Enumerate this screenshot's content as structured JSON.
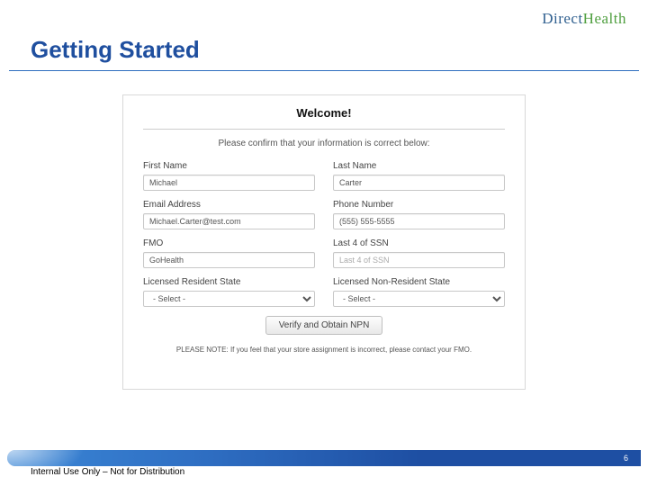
{
  "brand": {
    "part1": "Direct",
    "part2": "Health"
  },
  "title": "Getting Started",
  "welcome": "Welcome!",
  "confirm_text": "Please confirm that your information is correct below:",
  "fields": {
    "first_name": {
      "label": "First Name",
      "value": "Michael"
    },
    "last_name": {
      "label": "Last Name",
      "value": "Carter"
    },
    "email": {
      "label": "Email Address",
      "value": "Michael.Carter@test.com"
    },
    "phone": {
      "label": "Phone Number",
      "value": "(555) 555-5555"
    },
    "fmo": {
      "label": "FMO",
      "value": "GoHealth"
    },
    "ssn": {
      "label": "Last 4 of SSN",
      "value": "",
      "placeholder": "Last 4 of SSN"
    },
    "res_state": {
      "label": "Licensed Resident State",
      "selected": "- Select -"
    },
    "nonres_state": {
      "label": "Licensed Non-Resident State",
      "selected": "- Select -"
    }
  },
  "button_label": "Verify and Obtain NPN",
  "note": "PLEASE NOTE: If you feel that your store assignment is incorrect, please contact your FMO.",
  "footer": {
    "internal": "Internal Use Only – Not for Distribution",
    "page": "6"
  }
}
